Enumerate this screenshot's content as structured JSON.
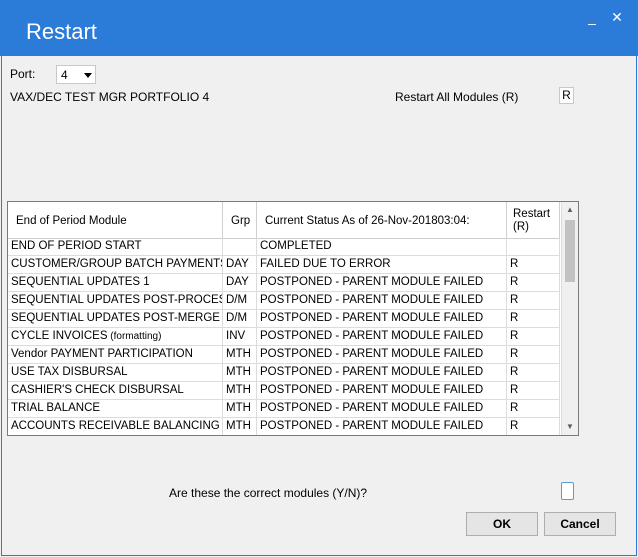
{
  "window": {
    "title": "Restart",
    "minimize_glyph": "_",
    "close_glyph": "✕"
  },
  "form": {
    "port_label": "Port:",
    "port_value": "4",
    "portfolio_name": "VAX/DEC TEST MGR PORTFOLIO 4",
    "restart_all_label": "Restart All Modules (R)",
    "restart_all_value": "R",
    "confirm_question": "Are these the correct modules (Y/N)?",
    "confirm_value": ""
  },
  "table": {
    "headers": {
      "module": "End of Period Module",
      "grp": "Grp",
      "status": "Current Status As of 26-Nov-201803:04:",
      "restart_line1": "Restart",
      "restart_line2": "(R)"
    },
    "rows": [
      {
        "module": "END OF PERIOD START",
        "grp": "",
        "status": "COMPLETED",
        "restart": ""
      },
      {
        "module": "CUSTOMER/GROUP BATCH PAYMENTS",
        "grp": "DAY",
        "status": "FAILED DUE TO ERROR",
        "restart": "R"
      },
      {
        "module": "SEQUENTIAL UPDATES  1",
        "grp": "DAY",
        "status": "POSTPONED - PARENT MODULE FAILED",
        "restart": "R"
      },
      {
        "module": "SEQUENTIAL UPDATES POST-PROCES",
        "grp": "D/M",
        "status": "POSTPONED - PARENT MODULE FAILED",
        "restart": "R"
      },
      {
        "module": "SEQUENTIAL UPDATES POST-MERGE",
        "grp": "D/M",
        "status": "POSTPONED - PARENT MODULE FAILED",
        "restart": "R"
      },
      {
        "module": "CYCLE INVOICES",
        "module_suffix": " (formatting)",
        "grp": "INV",
        "status": "POSTPONED - PARENT MODULE FAILED",
        "restart": "R"
      },
      {
        "module": "Vendor PAYMENT PARTICIPATION",
        "grp": "MTH",
        "status": "POSTPONED - PARENT MODULE FAILED",
        "restart": "R"
      },
      {
        "module": "USE TAX DISBURSAL",
        "grp": "MTH",
        "status": "POSTPONED - PARENT MODULE FAILED",
        "restart": "R"
      },
      {
        "module": "CASHIER'S CHECK DISBURSAL",
        "grp": "MTH",
        "status": "POSTPONED - PARENT MODULE FAILED",
        "restart": "R"
      },
      {
        "module": "TRIAL BALANCE",
        "grp": "MTH",
        "status": "POSTPONED - PARENT MODULE FAILED",
        "restart": "R"
      },
      {
        "module": "ACCOUNTS RECEIVABLE BALANCING",
        "grp": "MTH",
        "status": "POSTPONED - PARENT MODULE FAILED",
        "restart": "R"
      }
    ]
  },
  "buttons": {
    "ok": "OK",
    "cancel": "Cancel"
  },
  "colors": {
    "titlebar": "#2b7bd8",
    "background": "#f0f0f0"
  }
}
